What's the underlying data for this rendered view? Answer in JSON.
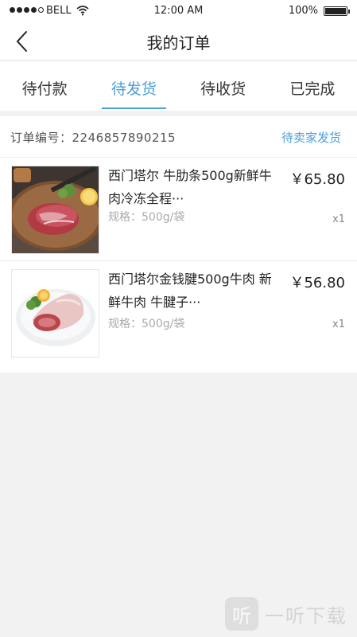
{
  "status_bar": {
    "carrier": "BELL",
    "time": "12:00 AM",
    "battery": "100%",
    "signal_icon": "signal-dots-icon",
    "wifi_icon": "wifi-icon",
    "battery_icon": "battery-icon"
  },
  "nav": {
    "title": "我的订单",
    "back_icon": "chevron-left-icon"
  },
  "tabs": [
    {
      "label": "待付款",
      "active": false
    },
    {
      "label": "待发货",
      "active": true
    },
    {
      "label": "待收货",
      "active": false
    },
    {
      "label": "已完成",
      "active": false
    }
  ],
  "order": {
    "number_label": "订单编号：",
    "number": "2246857890215",
    "status": "待卖家发货",
    "items": [
      {
        "title": "西门塔尔  牛肋条500g新鲜牛肉冷冻全程···",
        "spec": "规格：500g/袋",
        "price": "￥65.80",
        "qty": "x1",
        "image": "beef-steak-on-board-image"
      },
      {
        "title": "西门塔尔金钱腱500g牛肉  新鲜牛肉 牛腱子···",
        "spec": "规格：500g/袋",
        "price": "￥56.80",
        "qty": "x1",
        "image": "beef-shank-on-plate-image"
      }
    ]
  },
  "watermark": {
    "logo_char": "听",
    "text": "一听下载"
  },
  "colors": {
    "accent": "#4a9fd8",
    "background": "#f2f2f2"
  }
}
